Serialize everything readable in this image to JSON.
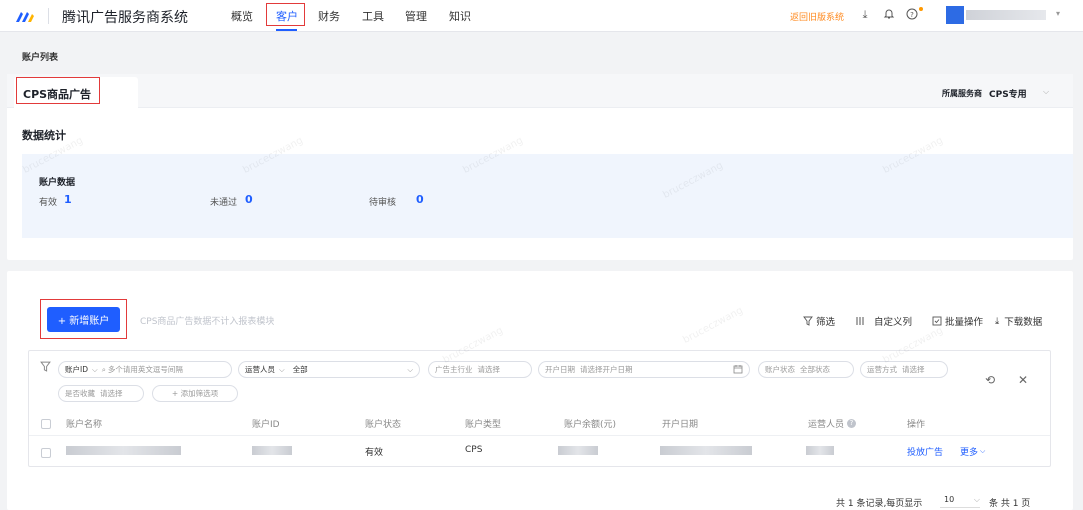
{
  "header": {
    "app_title": "腾讯广告服务商系统",
    "nav": [
      "概览",
      "客户",
      "财务",
      "工具",
      "管理",
      "知识"
    ],
    "active_nav": "客户",
    "back_link": "返回旧版系统",
    "accent": "#1f5eff"
  },
  "breadcrumb": "账户列表",
  "tabs": {
    "active": "CPS商品广告"
  },
  "service_provider": {
    "label": "所属服务商",
    "value": "CPS专用"
  },
  "stats": {
    "section_title": "数据统计",
    "panel_title": "账户数据",
    "items": [
      {
        "label": "有效",
        "value": "1"
      },
      {
        "label": "未通过",
        "value": "0"
      },
      {
        "label": "待审核",
        "value": "0"
      }
    ]
  },
  "actions": {
    "add_button": "+ 新增账户",
    "hint": "CPS商品广告数据不计入报表模块",
    "filter": "筛选",
    "custom_columns": "自定义列",
    "batch": "批量操作",
    "download": "下载数据"
  },
  "filters": {
    "id_select": "账户ID",
    "id_placeholder": "多个请用英文逗号间隔",
    "operator_label": "运营人员",
    "operator_value": "全部",
    "industry": {
      "label": "广告主行业",
      "placeholder": "请选择"
    },
    "open_date": {
      "label": "开户日期",
      "placeholder": "请选择开户日期"
    },
    "status": {
      "label": "账户状态",
      "placeholder": "全部状态"
    },
    "method": {
      "label": "运营方式",
      "placeholder": "请选择"
    },
    "collect": {
      "label": "是否收藏",
      "placeholder": "请选择"
    },
    "add_filter": "+ 添加筛选项"
  },
  "table": {
    "columns": [
      "账户名称",
      "账户ID",
      "账户状态",
      "账户类型",
      "账户余额(元)",
      "开户日期",
      "运营人员",
      "操作"
    ],
    "rows": [
      {
        "status": "有效",
        "type": "CPS",
        "action_primary": "投放广告",
        "action_more": "更多"
      }
    ]
  },
  "pagination": {
    "summary": "共 1 条记录,每页显示",
    "page_size": "10",
    "suffix": "条 共 1 页"
  },
  "watermark": "bruceczwang"
}
